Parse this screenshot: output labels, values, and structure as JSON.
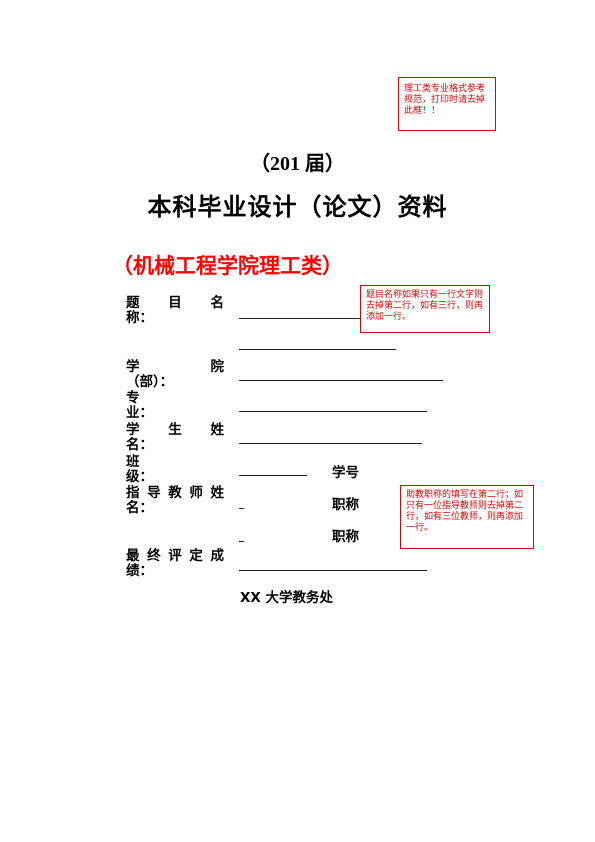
{
  "notes": {
    "format_note": "理工类专业格式参考规范，打印时请去掉此框！！",
    "title_note": "题目名称如果只有一行文字则去掉第二行，如有三行，则再添加一行。",
    "advisor_note": "助教职称的填写在第二行；如只有一位指导教师则去掉第二行，如有三位教师，则再添加一行。"
  },
  "header": {
    "year": "（201 届）",
    "title": "本科毕业设计（论文）资料",
    "college": "（机械工程学院理工类）"
  },
  "form": {
    "topic": {
      "chars": [
        "题",
        "目",
        "名"
      ],
      "line2": "称："
    },
    "school": {
      "chars": [
        "学",
        "院"
      ],
      "line2": "（部）："
    },
    "major": {
      "line1": "专",
      "line2": "业："
    },
    "student": {
      "chars": [
        "学",
        "生",
        "姓"
      ],
      "line2": "名："
    },
    "class": {
      "line1": "班",
      "line2": "级：",
      "student_id_label": "学号"
    },
    "advisor": {
      "chars": [
        "指",
        "导",
        "教",
        "师",
        "姓"
      ],
      "line2": "名：",
      "title_label_1": "职称",
      "title_label_2": "职称"
    },
    "grade": {
      "chars": [
        "最",
        "终",
        "评",
        "定",
        "成"
      ],
      "line2": "绩："
    }
  },
  "footer": {
    "issuer": "XX 大学教务处"
  }
}
